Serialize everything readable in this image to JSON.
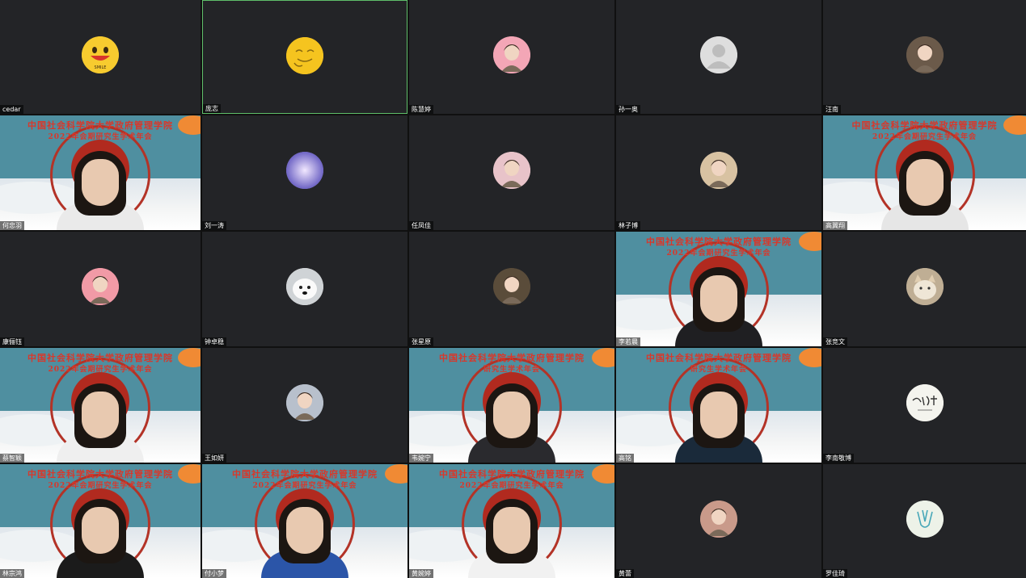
{
  "meeting": {
    "participants": [
      {
        "name": "cedar",
        "type": "avatar",
        "avatar_icon": "smile-emoji-icon",
        "color": "#f6c836"
      },
      {
        "name": "庞志",
        "type": "avatar",
        "avatar_icon": "smirk-emoji-icon",
        "color": "#f5c527",
        "active_speaker": true
      },
      {
        "name": "陈慧婷",
        "type": "avatar",
        "avatar_icon": "anime-girl-avatar-icon",
        "color": "#f3a6b6"
      },
      {
        "name": "孙一奥",
        "type": "avatar",
        "avatar_icon": "default-user-icon",
        "color": "#dcdcdc"
      },
      {
        "name": "汪南",
        "type": "avatar",
        "avatar_icon": "man-photo-avatar-icon",
        "color": "#6b5a4a"
      },
      {
        "name": "何忠羽",
        "type": "video",
        "background_text_1": "中国社会科学院大学政府管理学院",
        "background_text_2": "2022年会期研究生学术年会",
        "clothing": "#eaeaea"
      },
      {
        "name": "刘一涛",
        "type": "avatar",
        "avatar_icon": "purple-flower-avatar-icon",
        "color": "#8e86d6"
      },
      {
        "name": "任凤佳",
        "type": "avatar",
        "avatar_icon": "anime-girl-avatar-icon",
        "color": "#e8c3c9"
      },
      {
        "name": "林子博",
        "type": "avatar",
        "avatar_icon": "cartoon-boy-avatar-icon",
        "color": "#d8c2a2"
      },
      {
        "name": "高翼翔",
        "type": "video",
        "background_text_1": "中国社会科学院大学政府管理学院",
        "background_text_2": "2022年会期研究生学术年会",
        "clothing": "#e6e6e6"
      },
      {
        "name": "康俪钰",
        "type": "avatar",
        "avatar_icon": "anime-girl-avatar-icon",
        "color": "#f19aa6"
      },
      {
        "name": "钟卓稳",
        "type": "avatar",
        "avatar_icon": "white-dog-avatar-icon",
        "color": "#e4e4e4"
      },
      {
        "name": "张星原",
        "type": "avatar",
        "avatar_icon": "vintage-portrait-avatar-icon",
        "color": "#5a4c3a"
      },
      {
        "name": "李若晨",
        "type": "video",
        "background_text_1": "中国社会科学院大学政府管理学院",
        "background_text_2": "2022年会期研究生学术年会",
        "clothing": "#1f1f22"
      },
      {
        "name": "张竞文",
        "type": "avatar",
        "avatar_icon": "cat-avatar-icon",
        "color": "#c7b69e"
      },
      {
        "name": "蔡智颖",
        "type": "video",
        "background_text_1": "中国社会科学院大学政府管理学院",
        "background_text_2": "2022年会期研究生学术年会",
        "clothing": "#efefef"
      },
      {
        "name": "王如妍",
        "type": "avatar",
        "avatar_icon": "white-hair-avatar-icon",
        "color": "#b8c0cc"
      },
      {
        "name": "韦婉宁",
        "type": "video",
        "background_text_1": "中国社会科学院大学政府管理学院",
        "background_text_2": "研究生学术年会",
        "clothing": "#2a2a2e"
      },
      {
        "name": "高铭",
        "type": "video",
        "background_text_1": "中国社会科学院大学政府管理学院",
        "background_text_2": "研究生学术年会",
        "clothing": "#1a2a3a"
      },
      {
        "name": "李南敬博",
        "type": "avatar",
        "avatar_icon": "handwriting-avatar-icon",
        "color": "#f3f3ee"
      },
      {
        "name": "林宗鸿",
        "type": "video",
        "background_text_1": "中国社会科学院大学政府管理学院",
        "background_text_2": "2022年会期研究生学术年会",
        "clothing": "#1b1b1b"
      },
      {
        "name": "付小梦",
        "type": "video",
        "background_text_1": "中国社会科学院大学政府管理学院",
        "background_text_2": "2022年会期研究生学术年会",
        "clothing": "#2b55a8"
      },
      {
        "name": "黄婉婷",
        "type": "video",
        "background_text_1": "中国社会科学院大学政府管理学院",
        "background_text_2": "2022年会期研究生学术年会",
        "clothing": "#f1f1f1"
      },
      {
        "name": "黄蕾",
        "type": "avatar",
        "avatar_icon": "photo-girl-avatar-icon",
        "color": "#c99a8a"
      },
      {
        "name": "罗佳琦",
        "type": "avatar",
        "avatar_icon": "tulip-doodle-avatar-icon",
        "color": "#eef3ea"
      }
    ]
  },
  "colors": {
    "tile_bg": "#232427",
    "active_border": "#5fbf6a",
    "virtual_bg_teal": "#4f8fa0",
    "banner_red": "#d9372a"
  }
}
